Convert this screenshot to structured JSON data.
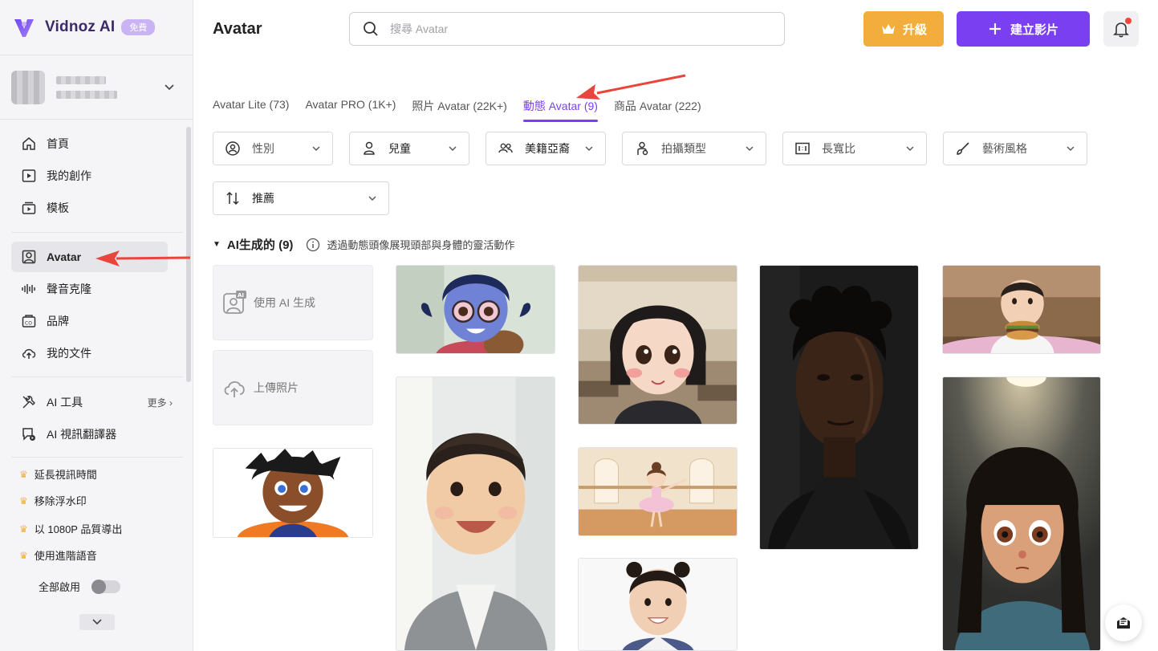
{
  "brand": {
    "name": "Vidnoz AI",
    "badge": "免費"
  },
  "sidebar": {
    "nav": [
      {
        "label": "首頁",
        "icon": "home-icon"
      },
      {
        "label": "我的創作",
        "icon": "play-icon"
      },
      {
        "label": "模板",
        "icon": "template-icon"
      }
    ],
    "nav2": [
      {
        "label": "Avatar",
        "icon": "avatar-icon",
        "active": true
      },
      {
        "label": "聲音克隆",
        "icon": "waveform-icon"
      },
      {
        "label": "品牌",
        "icon": "brand-icon"
      },
      {
        "label": "我的文件",
        "icon": "upload-cloud-icon"
      }
    ],
    "tools": [
      {
        "label": "AI 工具",
        "icon": "tools-icon",
        "more": "更多"
      },
      {
        "label": "AI 視訊翻譯器",
        "icon": "translate-icon"
      }
    ],
    "features": [
      "延長視訊時間",
      "移除浮水印",
      "以 1080P 品質導出",
      "使用進階語音"
    ],
    "toggle_label": "全部啟用"
  },
  "header": {
    "title": "Avatar",
    "search_placeholder": "搜尋 Avatar",
    "upgrade_label": "升級",
    "create_label": "建立影片"
  },
  "tabs": [
    {
      "label": "Avatar Lite (73)",
      "active": false
    },
    {
      "label": "Avatar PRO (1K+)",
      "active": false
    },
    {
      "label": "照片 Avatar (22K+)",
      "active": false
    },
    {
      "label": "動態 Avatar (9)",
      "active": true
    },
    {
      "label": "商品 Avatar (222)",
      "active": false
    }
  ],
  "filters": [
    {
      "label": "性別",
      "icon": "gender-icon",
      "set": false
    },
    {
      "label": "兒童",
      "icon": "child-icon",
      "set": true
    },
    {
      "label": "美籍亞裔",
      "icon": "people-icon",
      "set": true
    },
    {
      "label": "拍攝類型",
      "icon": "pose-icon",
      "set": false
    },
    {
      "label": "長寬比",
      "icon": "aspect-ratio-icon",
      "set": false
    },
    {
      "label": "藝術風格",
      "icon": "brush-icon",
      "set": false
    }
  ],
  "sort": {
    "label": "推薦",
    "icon": "sort-icon"
  },
  "section": {
    "title": "AI生成的 (9)",
    "description": "透過動態頭像展現頭部與身體的靈活動作"
  },
  "actions": {
    "generate_label": "使用 AI 生成",
    "upload_label": "上傳照片"
  },
  "colors": {
    "accent": "#7b3ff2",
    "upgrade": "#f3ad3c",
    "annotation_arrow": "#e8453c"
  }
}
